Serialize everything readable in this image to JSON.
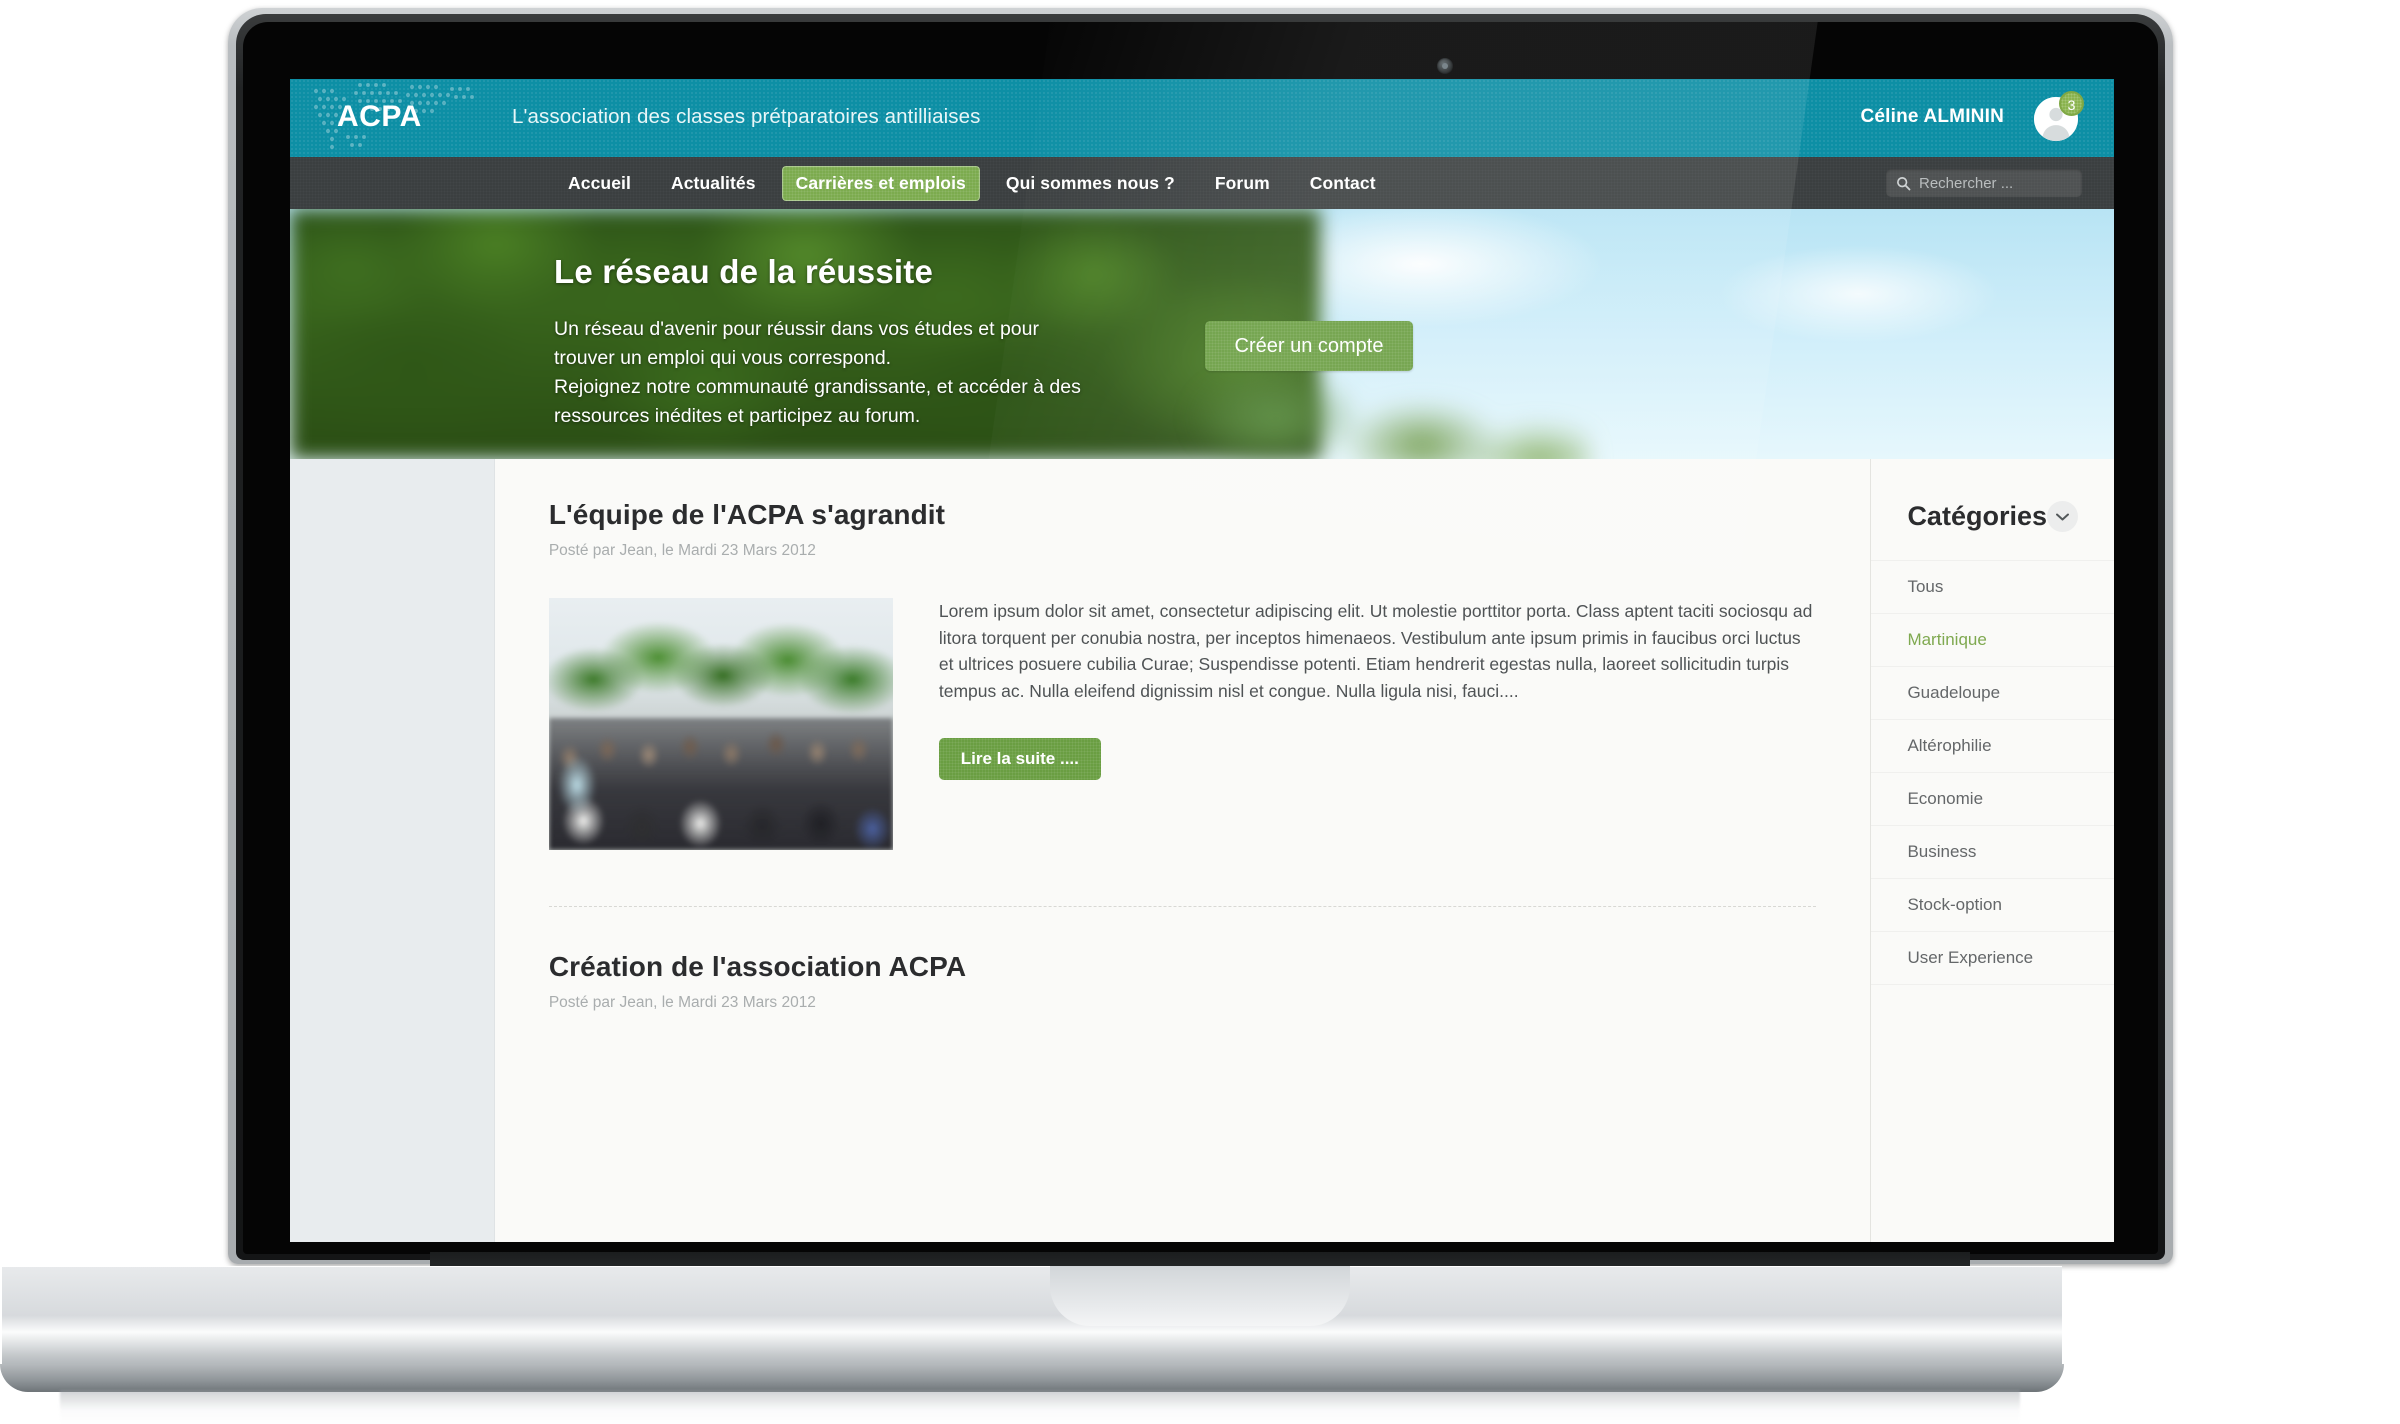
{
  "header": {
    "logo_text": "ACPA",
    "logo_icon": "dotted-map-icon",
    "tagline": "L'association des classes prétparatoires antilliaises",
    "user_name": "Céline ALMININ",
    "avatar_icon": "user-avatar-icon",
    "notification_count": "3",
    "brand_teal": "#0d8fa5",
    "accent_green": "#6a9e42"
  },
  "nav": {
    "items": [
      {
        "label": "Accueil",
        "active": false
      },
      {
        "label": "Actualités",
        "active": false
      },
      {
        "label": "Carrières et emplois",
        "active": true
      },
      {
        "label": "Qui sommes nous ?",
        "active": false
      },
      {
        "label": "Forum",
        "active": false
      },
      {
        "label": "Contact",
        "active": false
      }
    ],
    "search": {
      "icon": "search-icon",
      "placeholder": "Rechercher ...",
      "value": ""
    }
  },
  "hero": {
    "title": "Le réseau de la réussite",
    "subtitle": "Un réseau d'avenir pour réussir dans vos études et pour trouver un emploi qui vous correspond.\nRejoignez notre communauté grandissante, et accéder à des ressources inédites et participez au forum.",
    "cta_label": "Créer un compte"
  },
  "articles": [
    {
      "title": "L'équipe de l'ACPA s'agrandit",
      "meta": "Posté par Jean, le Mardi 23 Mars 2012",
      "image_alt": "group-photo",
      "body": "Lorem ipsum dolor sit amet, consectetur adipiscing elit. Ut molestie porttitor porta. Class aptent taciti sociosqu ad litora torquent per conubia nostra, per inceptos himenaeos. Vestibulum ante ipsum primis in faucibus orci luctus et ultrices posuere cubilia Curae; Suspendisse potenti. Etiam hendrerit egestas nulla, laoreet sollicitudin turpis tempus ac. Nulla eleifend dignissim nisl et congue. Nulla ligula nisi, fauci....",
      "read_more_label": "Lire la suite ...."
    },
    {
      "title": "Création de l'association ACPA",
      "meta": "Posté par Jean, le Mardi 23 Mars 2012"
    }
  ],
  "sidebar": {
    "title": "Catégories",
    "collapse_icon": "chevron-down-icon",
    "items": [
      {
        "label": "Tous",
        "active": false
      },
      {
        "label": "Martinique",
        "active": true
      },
      {
        "label": "Guadeloupe",
        "active": false
      },
      {
        "label": "Altérophilie",
        "active": false
      },
      {
        "label": "Economie",
        "active": false
      },
      {
        "label": "Business",
        "active": false
      },
      {
        "label": "Stock-option",
        "active": false
      },
      {
        "label": "User Experience",
        "active": false
      }
    ]
  }
}
